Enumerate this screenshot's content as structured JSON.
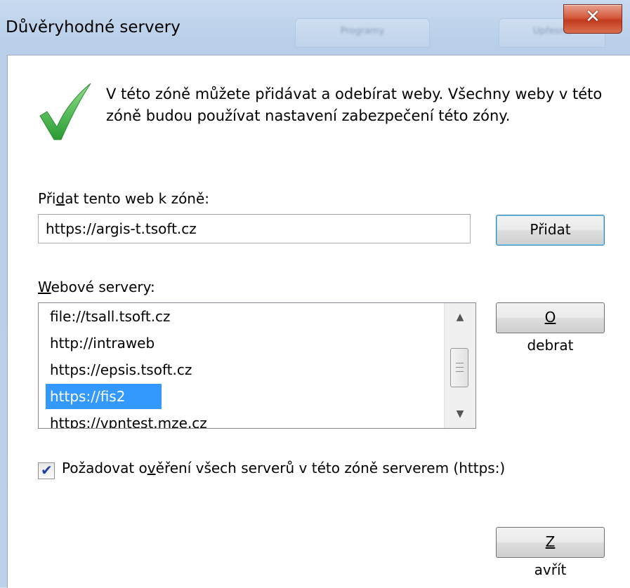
{
  "window": {
    "title": "Důvěryhodné servery",
    "close_glyph": "✕",
    "background_tabs": [
      "Programy",
      "Upřesnit"
    ]
  },
  "intro": {
    "text": "V této zóně můžete přidávat a odebírat weby. Všechny weby v této zóně budou používat nastavení zabezpečení této zóny.",
    "icon": "green-checkmark-icon"
  },
  "add_site": {
    "label_pre": "Při",
    "label_access": "d",
    "label_post": "at tento web k zóně:",
    "input_value": "https://argis-t.tsoft.cz",
    "button_label": "Přidat"
  },
  "servers": {
    "label_access": "W",
    "label_post": "ebové servery:",
    "items": [
      {
        "label": "file://tsall.tsoft.cz"
      },
      {
        "label": "http://intraweb"
      },
      {
        "label": "https://epsis.tsoft.cz"
      },
      {
        "label": "https://fis2",
        "selected": true
      },
      {
        "label": "https://vpntest.mze.cz"
      }
    ],
    "remove_button_access": "O",
    "remove_button_post": "debrat"
  },
  "require_https": {
    "checked": true,
    "label_pre": "Požadovat o",
    "label_access": "v",
    "label_post": "ěření všech serverů v této zóně serverem (https:)"
  },
  "footer": {
    "close_access": "Z",
    "close_post": "avřít"
  },
  "colors": {
    "selection": "#3399ff",
    "checkmark": "#3cb43c",
    "close_button": "#c8452a"
  }
}
